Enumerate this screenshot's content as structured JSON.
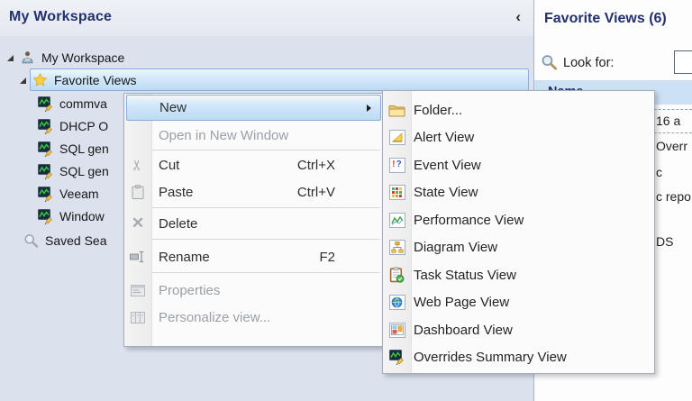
{
  "left_pane": {
    "title": "My Workspace",
    "collapse_glyph": "‹"
  },
  "tree": {
    "root_label": "My Workspace",
    "favorites_label": "Favorite Views",
    "view_items": [
      {
        "label": "commva",
        "icon": "overrides-view-icon"
      },
      {
        "label": "DHCP O",
        "icon": "overrides-view-icon"
      },
      {
        "label": "SQL gen",
        "icon": "overrides-view-icon"
      },
      {
        "label": "SQL gen",
        "icon": "overrides-view-icon"
      },
      {
        "label": "Veeam",
        "icon": "overrides-view-icon"
      },
      {
        "label": "Window",
        "icon": "overrides-view-icon"
      }
    ],
    "saved_searches_label": "Saved Sea"
  },
  "context_menu": {
    "items": [
      {
        "label": "New",
        "state": "highlighted",
        "has_submenu": true
      },
      {
        "label": "Open in New Window",
        "state": "disabled"
      },
      {
        "label": "Cut",
        "shortcut": "Ctrl+X",
        "icon": "scissors-icon"
      },
      {
        "label": "Paste",
        "shortcut": "Ctrl+V",
        "icon": "clipboard-icon"
      },
      {
        "label": "Delete",
        "icon": "delete-icon"
      },
      {
        "label": "Rename",
        "shortcut": "F2",
        "icon": "rename-icon"
      },
      {
        "label": "Properties",
        "state": "disabled",
        "icon": "properties-icon"
      },
      {
        "label": "Personalize view...",
        "state": "disabled",
        "icon": "personalize-icon"
      }
    ]
  },
  "submenu": {
    "items": [
      {
        "label": "Folder...",
        "icon": "folder-icon"
      },
      {
        "label": "Alert View",
        "icon": "alert-view-icon"
      },
      {
        "label": "Event View",
        "icon": "event-view-icon"
      },
      {
        "label": "State View",
        "icon": "state-view-icon"
      },
      {
        "label": "Performance View",
        "icon": "performance-view-icon"
      },
      {
        "label": "Diagram View",
        "icon": "diagram-view-icon"
      },
      {
        "label": "Task Status View",
        "icon": "task-status-view-icon"
      },
      {
        "label": "Web Page View",
        "icon": "web-page-view-icon"
      },
      {
        "label": "Dashboard View",
        "icon": "dashboard-view-icon"
      },
      {
        "label": "Overrides Summary View",
        "icon": "overrides-summary-view-icon"
      }
    ]
  },
  "right_panel": {
    "title": "Favorite Views (6)",
    "look_for_label": "Look for:",
    "look_for_value": "",
    "column_header": "Name",
    "row_fragments": [
      {
        "text": "16 a"
      },
      {
        "text": "Overr"
      },
      {
        "text": "c"
      },
      {
        "text": "c repo"
      },
      {
        "text": "DS"
      }
    ]
  },
  "colors": {
    "accent_navy": "#22306b",
    "selection_border": "#84aedb",
    "selection_fill": "#cfe6fa",
    "column_band": "#cde1f5",
    "pane_background": "#dbe2ee"
  }
}
